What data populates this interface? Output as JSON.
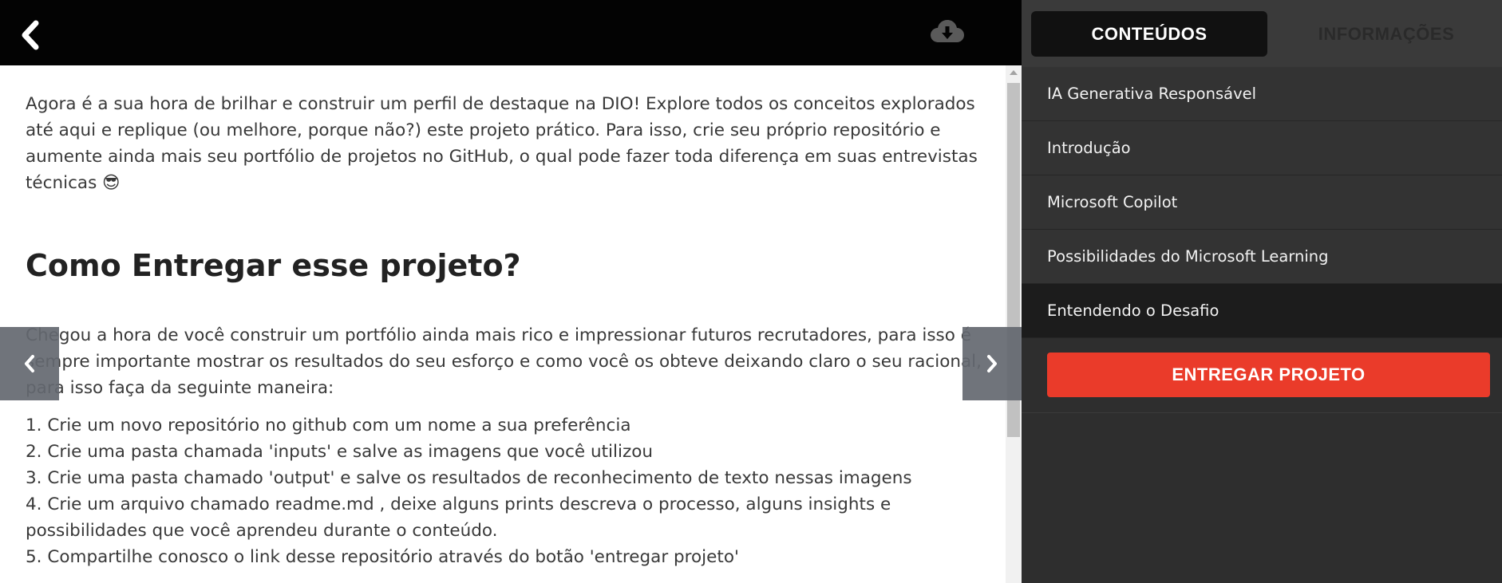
{
  "topbar": {
    "back_icon": "chevron-left-icon",
    "download_icon": "cloud-download-icon"
  },
  "content": {
    "intro": "Agora é a sua hora de brilhar e construir um perfil de destaque na DIO! Explore todos os conceitos explorados até aqui e replique (ou melhore, porque não?) este projeto prático. Para isso, crie seu próprio repositório e aumente ainda mais seu portfólio de projetos no GitHub, o qual pode fazer toda diferença em suas entrevistas técnicas",
    "intro_emoji": "😎",
    "heading": "Como Entregar esse projeto?",
    "paragraph": "Chegou a hora de você construir um portfólio ainda mais rico e impressionar futuros recrutadores, para isso é sempre importante mostrar os resultados do seu esforço e como você os obteve deixando claro o seu racional, para isso faça da seguinte maneira:",
    "steps": [
      "1. Crie um novo repositório no github com um nome a sua preferência",
      "2. Crie uma pasta chamada 'inputs' e salve as imagens que você utilizou",
      "3. Crie uma pasta chamado 'output' e salve os resultados de reconhecimento de texto nessas imagens",
      "4. Crie um arquivo chamado readme.md , deixe alguns prints descreva o processo, alguns insights e possibilidades que você aprendeu durante o conteúdo.",
      "5. Compartilhe conosco o link desse repositório através do botão 'entregar projeto'"
    ]
  },
  "sidebar": {
    "tabs": [
      {
        "label": "CONTEÚDOS",
        "active": true
      },
      {
        "label": "INFORMAÇÕES",
        "active": false
      }
    ],
    "items": [
      {
        "label": "IA Generativa Responsável"
      },
      {
        "label": "Introdução"
      },
      {
        "label": "Microsoft Copilot"
      },
      {
        "label": "Possibilidades do Microsoft Learning"
      },
      {
        "label": "Entendendo o Desafio",
        "active": true
      }
    ],
    "submit_label": "ENTREGAR PROJETO"
  },
  "colors": {
    "accent": "#ea3b2a",
    "topbar": "#030303",
    "sidebar": "#2e2e2e"
  }
}
